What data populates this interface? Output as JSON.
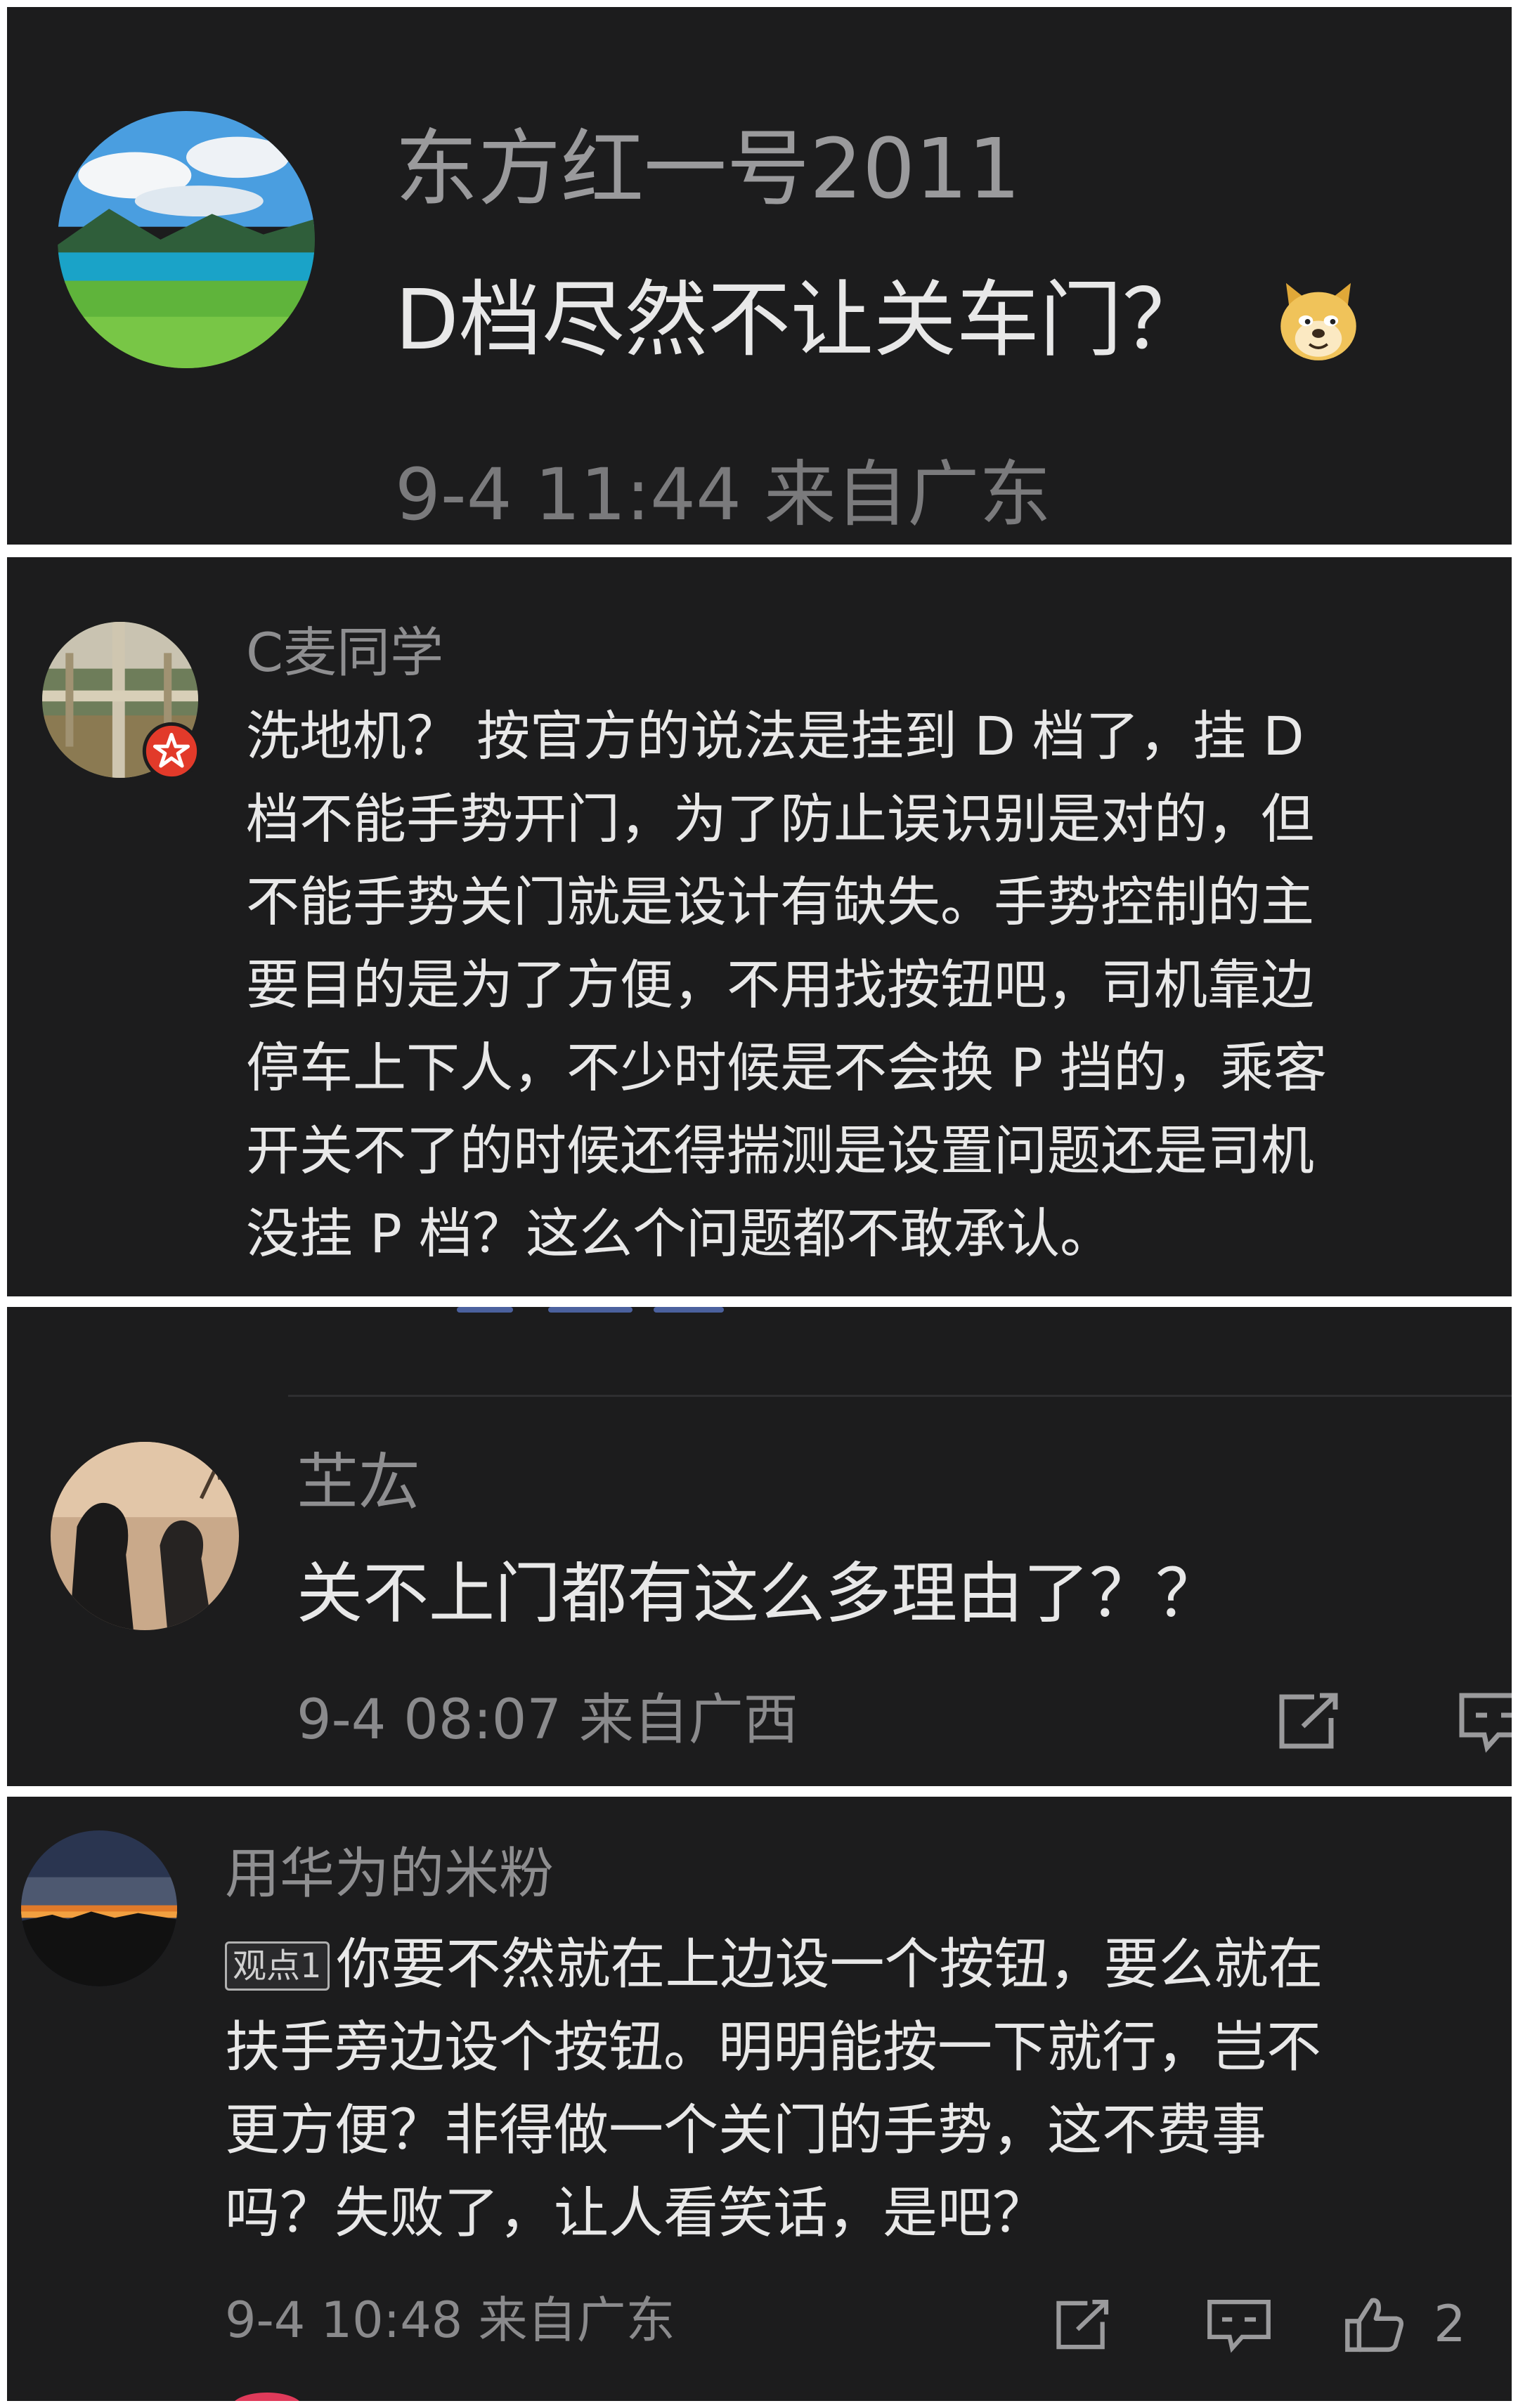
{
  "post": {
    "username": "东方红一号2011",
    "text": "D档尽然不让关车门？",
    "emoji": "doge-emoji",
    "meta": "9-4 11:44 来自广东"
  },
  "comment1": {
    "username": "C麦同学",
    "lines": [
      "洗地机？ 按官方的说法是挂到 D 档了，挂 D",
      "档不能手势开门，为了防止误识别是对的，但",
      "不能手势关门就是设计有缺失。手势控制的主",
      "要目的是为了方便，不用找按钮吧，司机靠边",
      "停车上下人，不少时候是不会换 P 挡的，乘客",
      "开关不了的时候还得揣测是设置问题还是司机",
      "没挂 P 档？这么个问题都不敢承认。"
    ]
  },
  "comment2": {
    "username": "芏厷",
    "text": "关不上门都有这么多理由了？？",
    "meta": "9-4 08:07 来自广西"
  },
  "comment3": {
    "username": "用华为的米粉",
    "badge": "观点1",
    "lines": [
      "你要不然就在上边设一个按钮，要么就在",
      "扶手旁边设个按钮。明明能按一下就行，岂不",
      "更方便？非得做一个关门的手势，这不费事",
      "吗？失败了，让人看笑话，是吧？"
    ],
    "meta": "9-4 10:48 来自广东",
    "like_count": "2"
  },
  "colors": {
    "panel_bg": "#1c1c1d",
    "text": "#e8e8e8",
    "muted": "#8e8e90",
    "link": "#5f7fd6"
  }
}
